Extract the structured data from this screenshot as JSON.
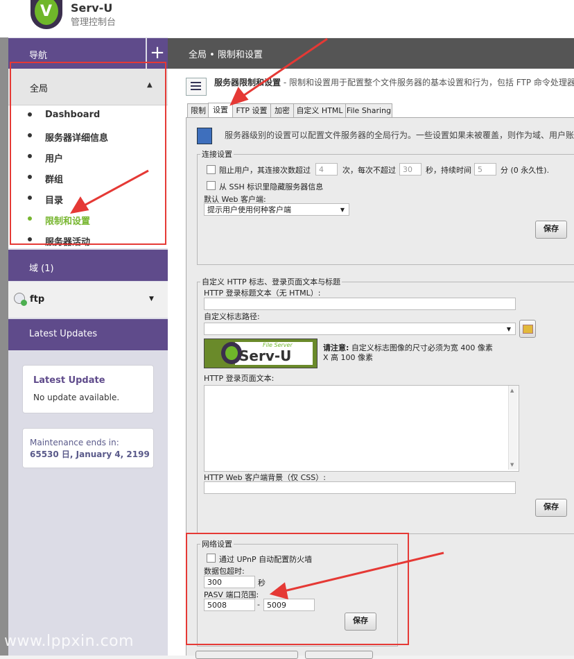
{
  "app": {
    "brand": "Serv-U",
    "subtitle": "管理控制台"
  },
  "sidebar": {
    "nav_header": "导航",
    "plus_label": "+",
    "global_section": "全局",
    "items": [
      {
        "label": "Dashboard",
        "active": false
      },
      {
        "label": "服务器详细信息",
        "active": false
      },
      {
        "label": "用户",
        "active": false
      },
      {
        "label": "群组",
        "active": false
      },
      {
        "label": "目录",
        "active": false
      },
      {
        "label": "限制和设置",
        "active": true
      },
      {
        "label": "服务器活动",
        "active": false
      }
    ],
    "domain_header": "域 (1)",
    "domain_selected": "ftp",
    "updates_header": "Latest Updates",
    "update_card": {
      "title": "Latest Update",
      "body": "No update available."
    },
    "maintenance_card": {
      "line1": "Maintenance ends in:",
      "line2": "65530 日, January 4, 2199"
    }
  },
  "content": {
    "breadcrumb": "全局 • 限制和设置",
    "desc_title": "服务器限制和设置",
    "desc_text": " - 限制和设置用于配置整个文件服务器的基本设置和行为，包括 FTP 命令处理器",
    "tabs": [
      "限制",
      "设置",
      "FTP 设置",
      "加密",
      "自定义 HTML",
      "File Sharing"
    ],
    "active_tab": "设置",
    "panel_desc": "服务器级别的设置可以配置文件服务器的全局行为。一些设置如果未被覆盖，则作为域、用户账",
    "connection": {
      "legend": "连接设置",
      "block_text_a": "阻止用户，其连接次数超过",
      "attempts": "4",
      "block_text_b": "次，每次不超过",
      "seconds": "30",
      "block_text_c": "秒，持续时间",
      "minutes": "5",
      "block_text_d": "分 (0 永久性).",
      "hide_ssh": "从 SSH 标识里隐藏服务器信息",
      "web_client_label": "默认 Web 客户端:",
      "web_client_value": "提示用户使用何种客户端",
      "save": "保存"
    },
    "custom_http": {
      "legend": "自定义 HTTP 标志、登录页面文本与标题",
      "title_label": "HTTP 登录标题文本（无 HTML）:",
      "title_value": "",
      "logo_path_label": "自定义标志路径:",
      "logo_small": "File Server",
      "logo_big": "Serv-U",
      "note_bold": "请注意:",
      "note_text": " 自定义标志图像的尺寸必须为宽 400 像素",
      "note_text2": "X 高 100 像素",
      "login_text_label": "HTTP 登录页面文本:",
      "css_label": "HTTP Web 客户端背景（仅 CSS）:",
      "save": "保存"
    },
    "network": {
      "legend": "网络设置",
      "upnp": "通过 UPnP 自动配置防火墙",
      "timeout_label": "数据包超时:",
      "timeout": "300",
      "timeout_unit": "秒",
      "pasv_label": "PASV 端口范围:",
      "pasv_from": "5008",
      "pasv_sep": "-",
      "pasv_to": "5009",
      "save": "保存"
    }
  },
  "watermark": "www.lppxin.com",
  "colors": {
    "purple": "#5f4b8b",
    "active_green": "#77b62f",
    "annotation_red": "#e53935"
  }
}
